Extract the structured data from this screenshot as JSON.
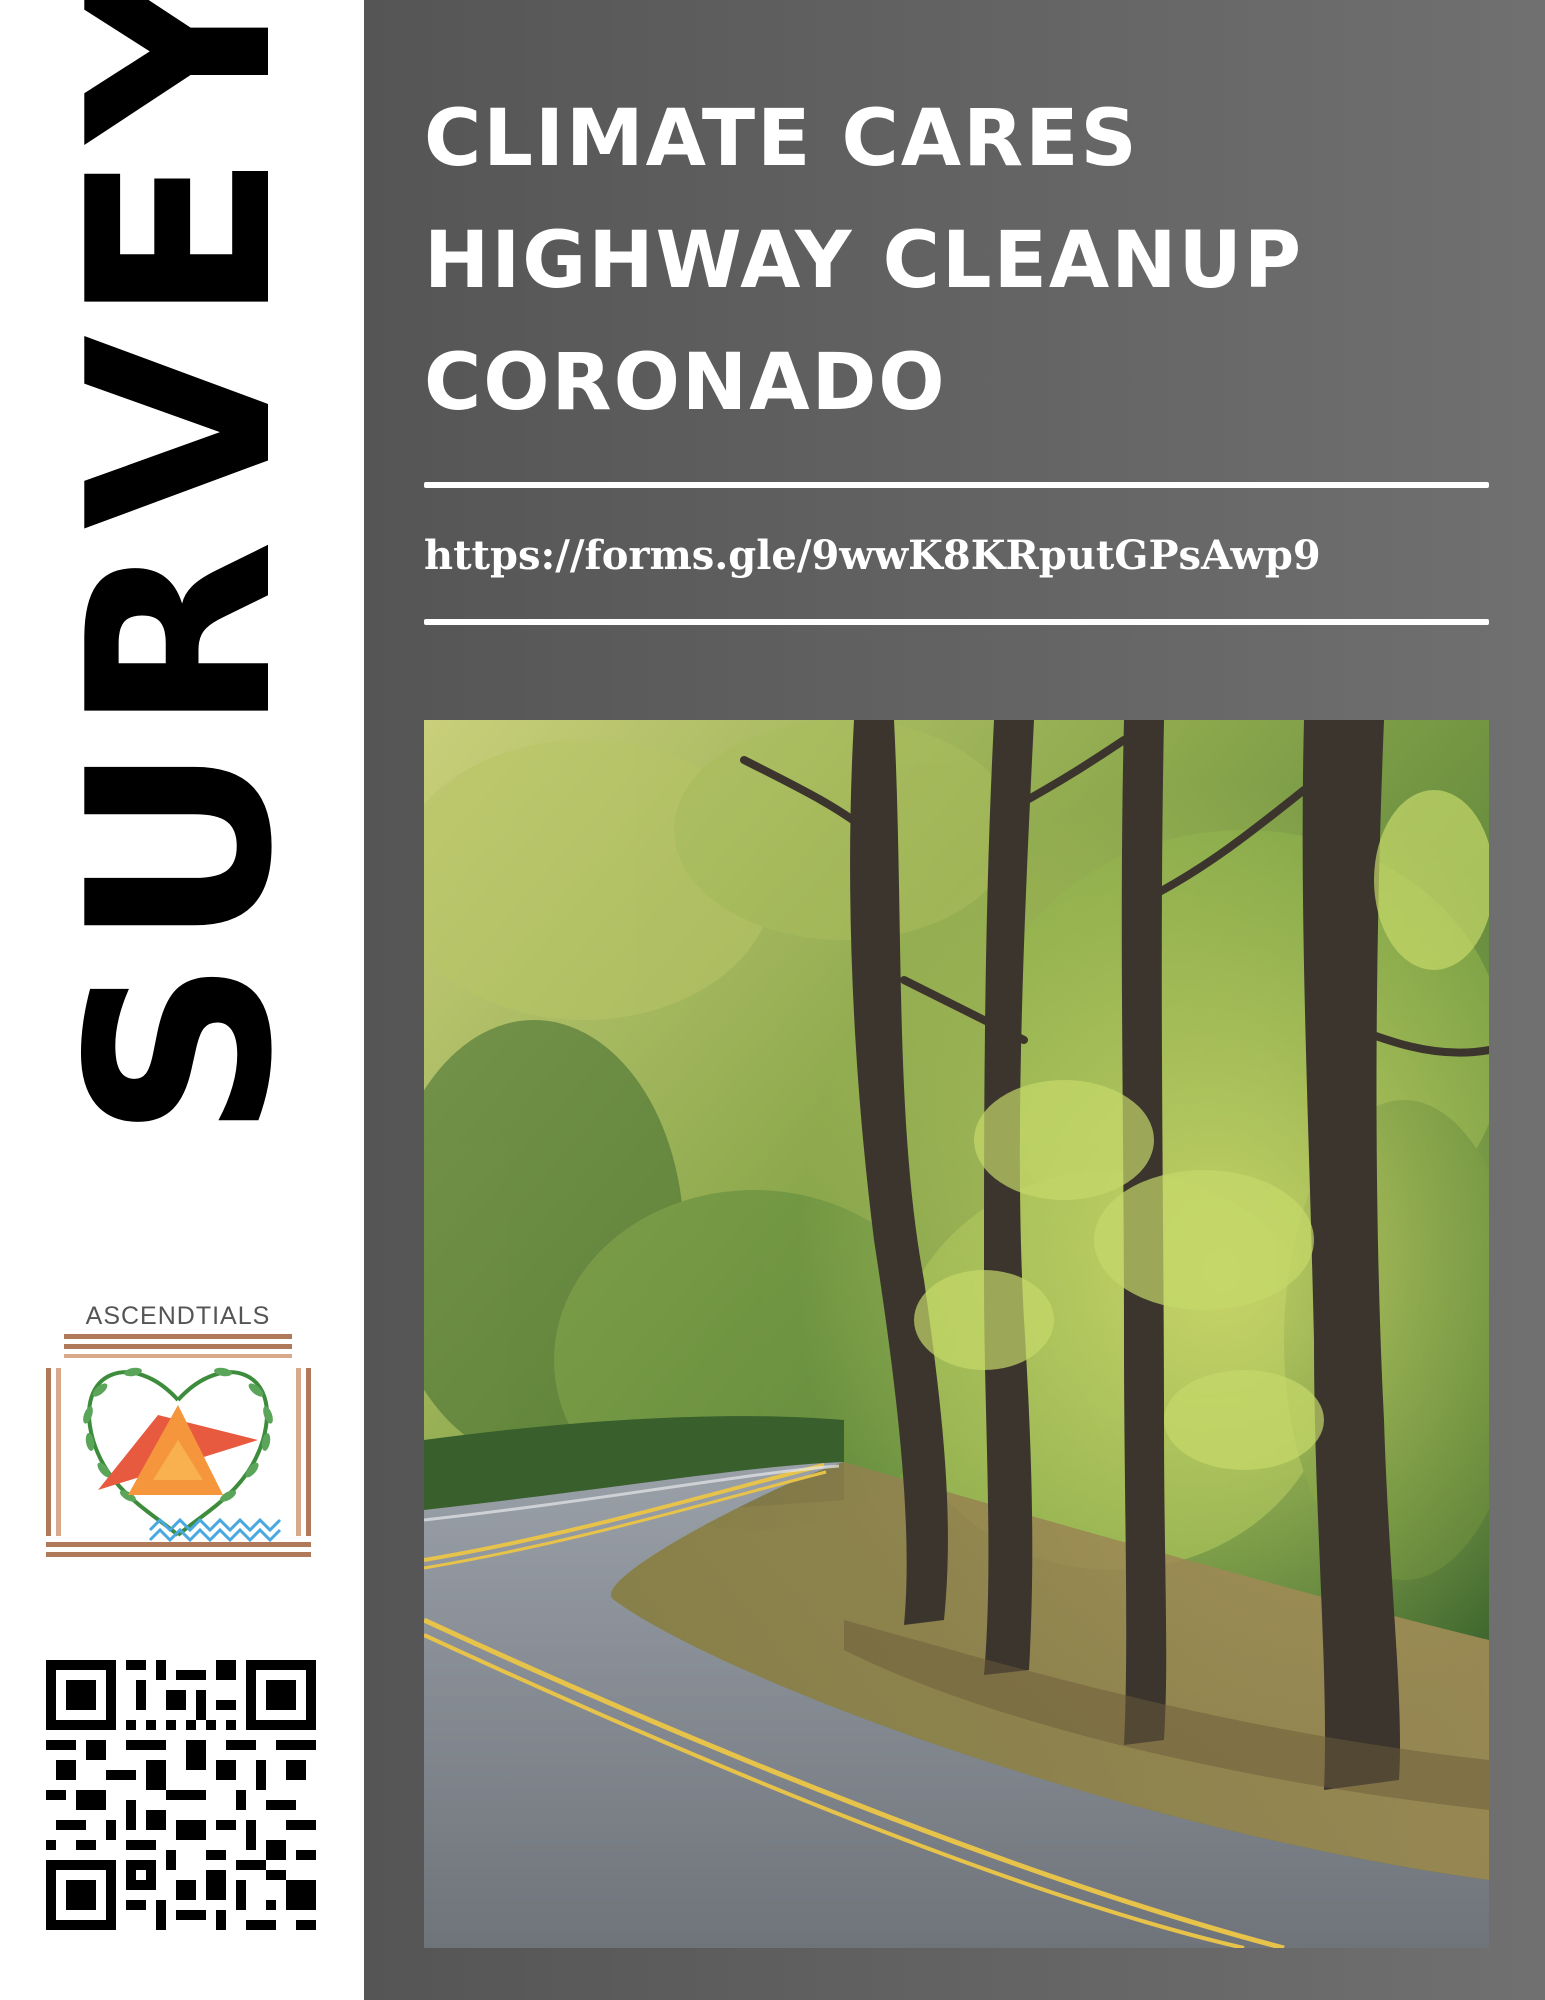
{
  "sidebar": {
    "vertical_title": "SURVEY",
    "logo": {
      "brand_name": "ASCENDTIALS",
      "icon": "ascendtials-logo-icon"
    },
    "qr": {
      "icon": "qr-code-icon"
    }
  },
  "main": {
    "title_lines": [
      "CLIMATE CARES",
      "HIGHWAY CLEANUP",
      "CORONADO"
    ],
    "survey_url": "https://forms.gle/9wwK8KRputGPsAwp9",
    "photo": {
      "icon": "forest-road-photo"
    }
  },
  "colors": {
    "panel_dark": "#555555",
    "panel_light": "#707070",
    "text_light": "#ffffff",
    "text_dark": "#000000",
    "logo_brown": "#b07a5a",
    "logo_red": "#e85a40",
    "logo_orange": "#f5963c",
    "logo_green": "#3c8c3c",
    "logo_blue": "#4aa8e0",
    "road_line": "#e8c34a"
  }
}
